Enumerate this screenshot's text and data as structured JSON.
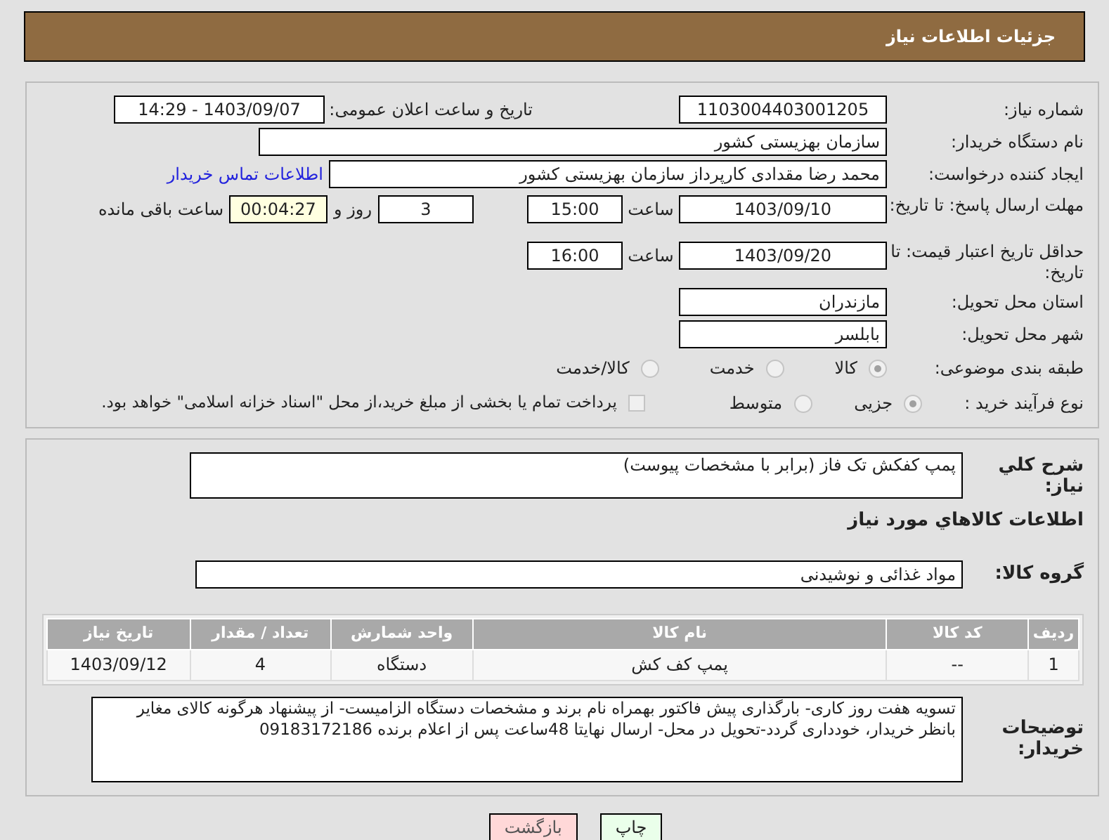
{
  "header": {
    "title": "جزئیات اطلاعات نیاز"
  },
  "need_number": {
    "label": "شماره نیاز:",
    "value": "1103004403001205"
  },
  "announce": {
    "label": "تاریخ و ساعت اعلان عمومی:",
    "value": "1403/09/07 - 14:29"
  },
  "buyer_org": {
    "label": "نام دستگاه خریدار:",
    "value": "سازمان بهزیستی کشور"
  },
  "requester": {
    "label": "ایجاد کننده درخواست:",
    "value": "محمد رضا  مقدادی کارپرداز سازمان بهزیستی کشور",
    "link": "اطلاعات تماس خریدار"
  },
  "reply_deadline": {
    "label": "مهلت ارسال پاسخ: تا تاریخ:",
    "date": "1403/09/10",
    "time_label": "ساعت",
    "time": "15:00",
    "days": "3",
    "days_label": "روز و",
    "remaining": "00:04:27",
    "remaining_label": "ساعت باقی مانده"
  },
  "price_validity": {
    "label": "حداقل تاریخ اعتبار قیمت: تا تاریخ:",
    "date": "1403/09/20",
    "time_label": "ساعت",
    "time": "16:00"
  },
  "province": {
    "label": "استان محل تحویل:",
    "value": "مازندران"
  },
  "city": {
    "label": "شهر محل تحویل:",
    "value": "بابلسر"
  },
  "category": {
    "label": "طبقه بندی موضوعی:",
    "options": [
      {
        "label": "کالا",
        "selected": true
      },
      {
        "label": "خدمت",
        "selected": false
      },
      {
        "label": "کالا/خدمت",
        "selected": false
      }
    ]
  },
  "purchase_process": {
    "label": "نوع فرآیند خرید :",
    "options": [
      {
        "label": "جزیی",
        "selected": true
      },
      {
        "label": "متوسط",
        "selected": false
      }
    ],
    "payment": {
      "label": "پرداخت تمام یا بخشی از مبلغ خرید،از محل \"اسناد خزانه اسلامی\" خواهد بود.",
      "checked": false
    }
  },
  "description": {
    "label": "شرح كلي نياز:",
    "value": "پمپ کفکش تک فاز (برابر با مشخصات پیوست)"
  },
  "goods_heading": "اطلاعات كالاهاي مورد نياز",
  "goods_group": {
    "label": "گروه کالا:",
    "value": "مواد غذائی و نوشیدنی"
  },
  "table": {
    "columns": [
      "ردیف",
      "کد کالا",
      "نام کالا",
      "واحد شمارش",
      "تعداد / مقدار",
      "تاریخ نیاز"
    ],
    "rows": [
      [
        "1",
        "--",
        "پمپ کف کش",
        "دستگاه",
        "4",
        "1403/09/12"
      ]
    ]
  },
  "buyer_notes": {
    "label": "توضیحات خریدار:",
    "value": "تسویه  هفت روز کاری- بارگذاری پیش فاکتور بهمراه نام برند و مشخصات دستگاه الزامیست- از پیشنهاد هرگونه کالای مغایر بانظر خریدار، خودداری گردد-تحویل در محل- ارسال نهایتا 48ساعت پس از اعلام برنده 09183172186"
  },
  "buttons": [
    {
      "label": "چاپ",
      "kind": "print"
    },
    {
      "label": "بازگشت",
      "kind": "back"
    }
  ]
}
